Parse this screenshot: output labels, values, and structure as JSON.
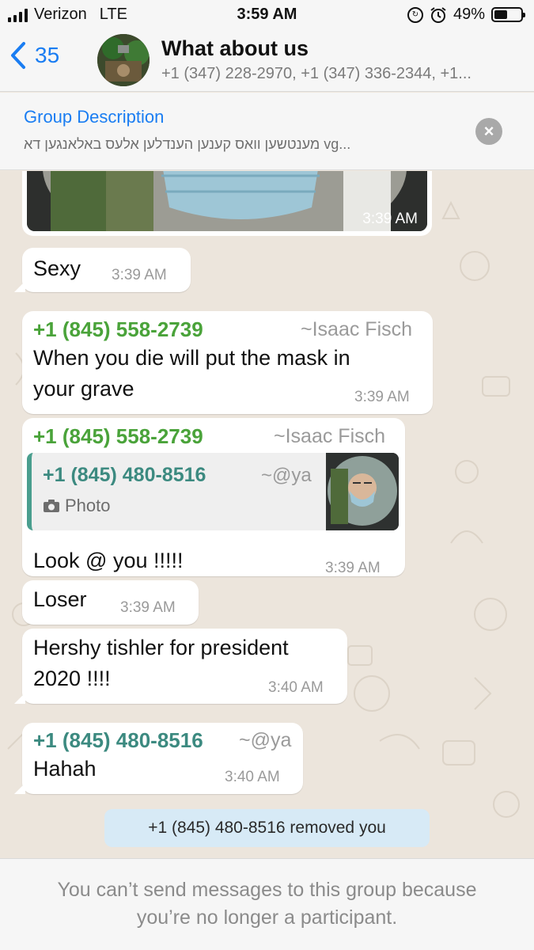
{
  "status_bar": {
    "carrier": "Verizon",
    "network": "LTE",
    "time": "3:59 AM",
    "battery": "49%",
    "battery_level": 0.49
  },
  "header": {
    "back_count": "35",
    "title": "What about us",
    "members": "+1 (347) 228-2970, +1 (347) 336-2344, +1..."
  },
  "description": {
    "title": "Group Description",
    "text": "מענטשען וואס קענען הענדלען אלעס באלאנגען דא vg..."
  },
  "messages": {
    "photo_time": "3:39 AM",
    "m1": {
      "text": "Sexy",
      "time": "3:39 AM"
    },
    "m2": {
      "sender": "+1 (845) 558-2739",
      "pushname": "~Isaac Fisch",
      "line1": "When you die will put the mask in",
      "line2": "your grave",
      "time": "3:39 AM"
    },
    "m3": {
      "sender": "+1 (845) 558-2739",
      "pushname": "~Isaac Fisch",
      "quote_sender": "+1 (845) 480-8516",
      "quote_pushname": "~@ya",
      "quote_label": "Photo",
      "text": "Look @ you !!!!!",
      "time": "3:39 AM"
    },
    "m4": {
      "text": "Loser",
      "time": "3:39 AM"
    },
    "m5": {
      "line1": "Hershy tishler for president",
      "line2": "2020 !!!!",
      "time": "3:40 AM"
    },
    "m6": {
      "sender": "+1 (845) 480-8516",
      "pushname": "~@ya",
      "text": "Hahah",
      "time": "3:40 AM"
    }
  },
  "system_message": "+1 (845) 480-8516 removed you",
  "footer": {
    "line1": "You can’t send messages to this group because",
    "line2": "you’re no longer a participant."
  },
  "colors": {
    "accent": "#1a7df2",
    "sender_green": "#4aa33a",
    "sender_teal": "#3c8a80",
    "system_bg": "#d7eaf6"
  }
}
